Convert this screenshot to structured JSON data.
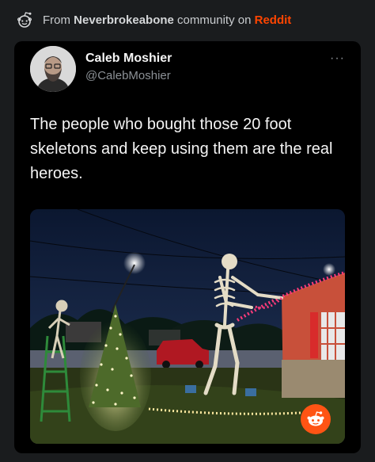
{
  "header": {
    "from_prefix": "From ",
    "community": "Neverbrokeabone",
    "community_suffix": " community on ",
    "site": "Reddit",
    "icon": "reddit-logo-icon"
  },
  "tweet": {
    "author_name": "Caleb Moshier",
    "author_handle": "@CalebMoshier",
    "more_icon": "···",
    "text": "The people who bought those 20 foot skeletons and keep using them are the real heroes."
  },
  "colors": {
    "background": "#1a1c1e",
    "card": "#000000",
    "reddit_orange": "#ff4500"
  }
}
